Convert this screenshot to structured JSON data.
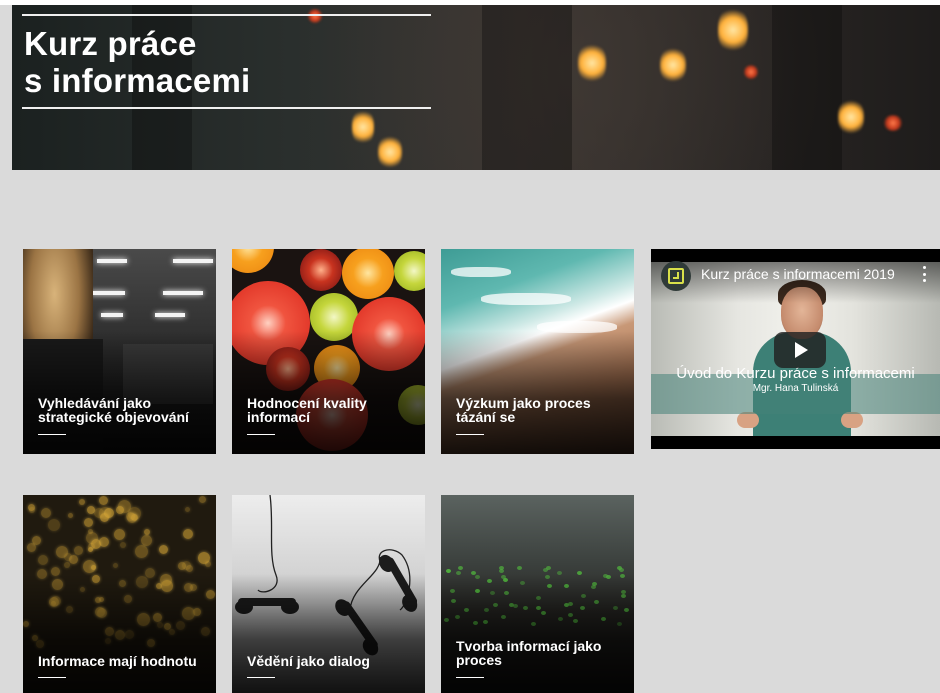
{
  "hero": {
    "title_line1": "Kurz práce",
    "title_line2": "s informacemi"
  },
  "cards": [
    {
      "title": "Vyhledávání jako strategické objevování",
      "image": "store-shelves-woman"
    },
    {
      "title": "Hodnocení kvality informací",
      "image": "citrus-slices"
    },
    {
      "title": "Výzkum jako proces tázání se",
      "image": "beach-waves"
    },
    {
      "title": "Informace mají hodnotu",
      "image": "golden-bokeh"
    },
    {
      "title": "Vědění jako dialog",
      "image": "telephone-handsets"
    },
    {
      "title": "Tvorba informací jako proces",
      "image": "sprouts-soil"
    }
  ],
  "video": {
    "title": "Kurz práce s informacemi 2019",
    "caption_main": "Úvod do Kurzu práce s informacemi",
    "caption_sub": "Mgr. Hana Tulinská",
    "icons": [
      "channel-logo-icon",
      "more-options-icon",
      "play-icon"
    ]
  },
  "colors": {
    "background": "#dadada",
    "text_on_image": "#ffffff",
    "video_band": "#46827a",
    "channel_accent": "#d8e04a"
  }
}
